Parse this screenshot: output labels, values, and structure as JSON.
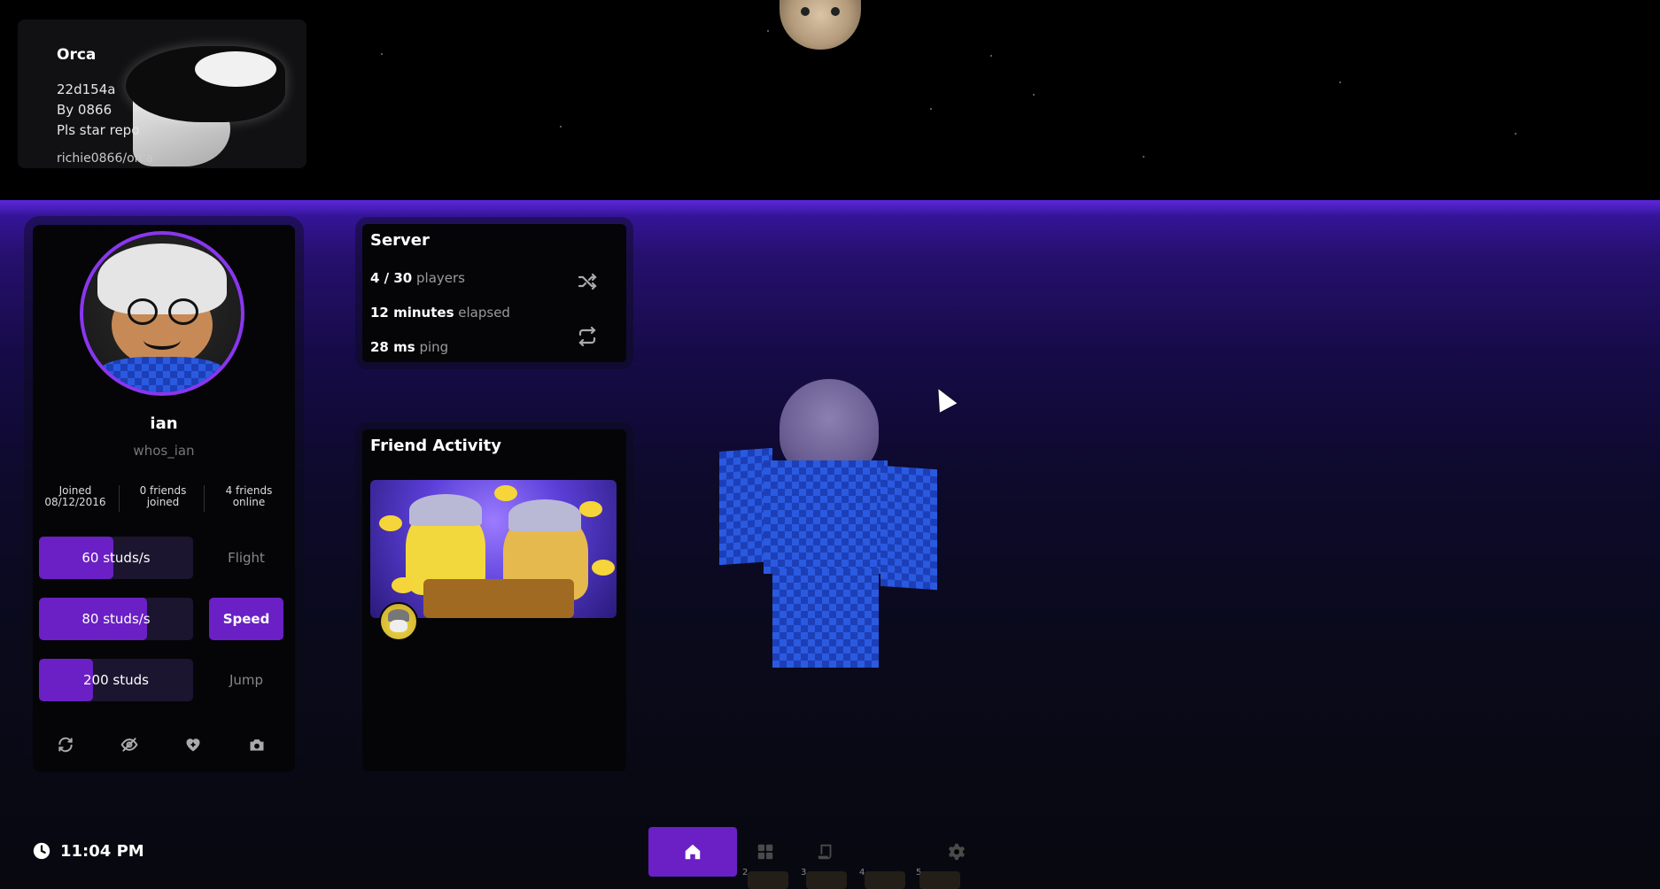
{
  "orca": {
    "title": "Orca",
    "version": "22d154a",
    "author": "By 0866",
    "tagline": "Pls star repo",
    "repo": "richie0866/orca"
  },
  "profile": {
    "display_name": "ian",
    "username": "whos_ian",
    "stats": [
      {
        "top": "Joined",
        "bottom": "08/12/2016"
      },
      {
        "top": "0 friends",
        "bottom": "joined"
      },
      {
        "top": "4 friends",
        "bottom": "online"
      }
    ],
    "rows": [
      {
        "value": "60 studs/s",
        "toggle": "Flight",
        "level": 0.48,
        "active": false
      },
      {
        "value": "80 studs/s",
        "toggle": "Speed",
        "level": 0.7,
        "active": true
      },
      {
        "value": "200 studs",
        "toggle": "Jump",
        "level": 0.35,
        "active": false
      }
    ],
    "actions": [
      "refresh-icon",
      "eye-off-icon",
      "heart-plus-icon",
      "camera-icon"
    ]
  },
  "server": {
    "title": "Server",
    "players_value": "4 / 30",
    "players_label": "players",
    "elapsed_value": "12 minutes",
    "elapsed_label": "elapsed",
    "ping_value": "28 ms",
    "ping_label": "ping",
    "icons": [
      "shuffle-icon",
      "rejoin-icon"
    ]
  },
  "friends": {
    "title": "Friend Activity"
  },
  "clock": {
    "time": "11:04 PM"
  },
  "dock": {
    "items": [
      "home-icon",
      "apps-icon",
      "scripts-icon",
      "settings-icon"
    ],
    "active": "home-icon"
  },
  "hotbar": {
    "slots": [
      "2",
      "3",
      "4",
      "5"
    ]
  },
  "colors": {
    "accent": "#6a20c4",
    "avatar_ring": "#8a36f0",
    "panel_bg": "#050507"
  }
}
